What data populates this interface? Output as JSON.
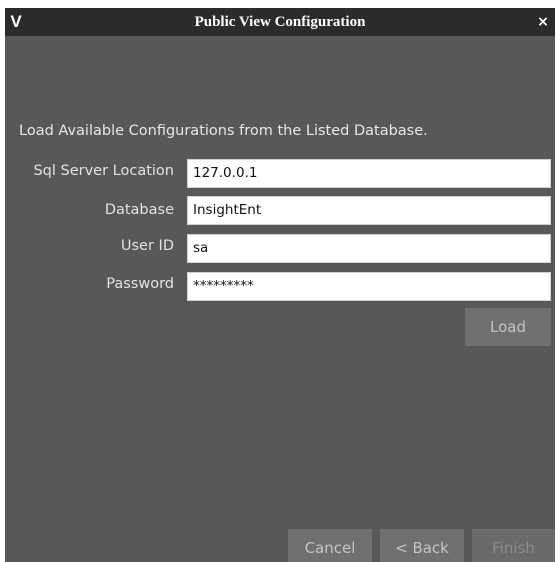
{
  "window": {
    "title": "Public View Configuration",
    "app_icon_glyph": "V",
    "close_glyph": "×"
  },
  "intro_text": "Load Available Configurations from the Listed Database.",
  "fields": [
    {
      "label": "Sql Server Location",
      "value": "127.0.0.1"
    },
    {
      "label": "Database",
      "value": "InsightEnt"
    },
    {
      "label": "User ID",
      "value": "sa"
    },
    {
      "label": "Password",
      "value": "*********"
    }
  ],
  "buttons": {
    "load": "Load",
    "cancel": "Cancel",
    "back": "< Back",
    "finish": "Finish"
  },
  "colors": {
    "titlebar": "#2b2b2b",
    "panel": "#585858",
    "button": "#707070"
  }
}
